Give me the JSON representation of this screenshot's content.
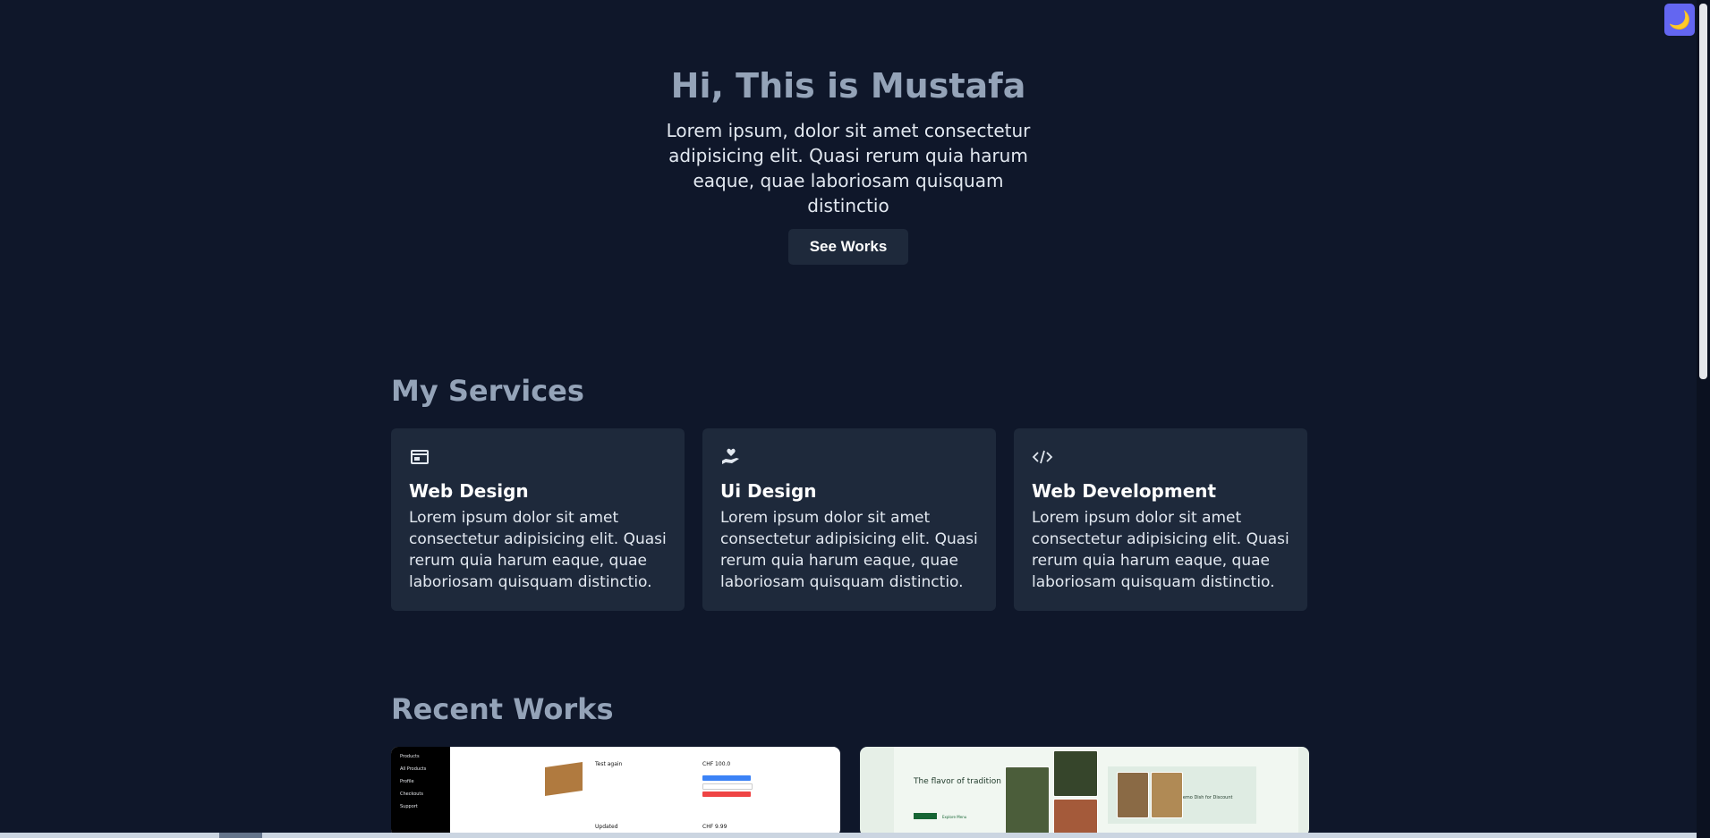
{
  "theme_toggle": {
    "icon": "moon-icon",
    "glyph": "🌙"
  },
  "hero": {
    "title": "Hi, This is Mustafa",
    "text": "Lorem ipsum, dolor sit amet consectetur adipisicing elit. Quasi rerum quia harum eaque, quae laboriosam quisquam distinctio",
    "button": "See Works"
  },
  "services": {
    "title": "My Services",
    "items": [
      {
        "icon": "browser-window-icon",
        "title": "Web Design",
        "text": "Lorem ipsum dolor sit amet consectetur adipisicing elit. Quasi rerum quia harum eaque, quae laboriosam quisquam distinctio."
      },
      {
        "icon": "heart-hand-icon",
        "title": "Ui Design",
        "text": "Lorem ipsum dolor sit amet consectetur adipisicing elit. Quasi rerum quia harum eaque, quae laboriosam quisquam distinctio."
      },
      {
        "icon": "code-icon",
        "title": "Web Development",
        "text": "Lorem ipsum dolor sit amet consectetur adipisicing elit. Quasi rerum quia harum eaque, quae laboriosam quisquam distinctio."
      }
    ]
  },
  "works": {
    "title": "Recent Works",
    "items": [
      {
        "name": "shop-admin-screenshot",
        "sidebar": [
          "Products",
          "All Products",
          "Profile",
          "Checkouts",
          "Support"
        ],
        "product": "Test again",
        "price": "CHF 100.0",
        "product2": "Updated",
        "price2": "CHF 9.99"
      },
      {
        "name": "restaurant-screenshot",
        "headline": "The flavor of tradition",
        "link": "Explore Menu",
        "promo": "Demo Dish for Discount"
      }
    ]
  },
  "colors": {
    "background": "#0f172a",
    "card": "#1e293b",
    "muted": "#94a3b8",
    "toggle": "#6366f1"
  }
}
